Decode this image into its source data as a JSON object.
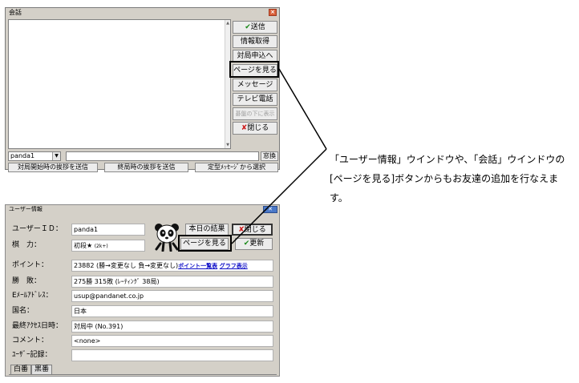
{
  "chat": {
    "title": "会話",
    "buttons": {
      "send": "送信",
      "get_info": "情報取得",
      "request_match": "対局申込へ",
      "view_page": "ページを見る",
      "message": "メッセージ",
      "tv_phone": "テレビ電話",
      "show_below_board": "碁盤の下に表示",
      "close": "閉じる"
    },
    "user_select_value": "panda1",
    "window_button": "窓換",
    "bottom_buttons": {
      "start_greeting": "対局開始時の挨拶を送信",
      "end_greeting": "終局時の挨拶を送信",
      "template_message": "定型ﾒｯｾｰｼﾞから選択"
    }
  },
  "note": {
    "text": "「ユーザー情報」ウインドウや、「会話」ウインドウの[ページを見る]ボタンからもお友達の追加を行なえます。"
  },
  "user_info": {
    "title": "ユーザー情報",
    "close_x": "✕",
    "fields": {
      "user_id_label": "ユーザーＩＤ：",
      "user_id_value": "panda1",
      "rank_label": "棋　力：",
      "rank_value": "初段★",
      "rank_suffix": "(2k+)",
      "points_label": "ポイント：",
      "points_value": "23882 (勝→変更なし 負→変更なし)",
      "points_link1": "ポイント一覧表",
      "points_link2": "グラフ表示",
      "record_label": "勝　敗：",
      "record_value": "275勝 315敗 (ﾚｰﾃｨﾝｸﾞ 38局)",
      "email_label": "Eﾒｰﾙｱﾄﾞﾚｽ：",
      "email_value": "usup@pandanet.co.jp",
      "country_label": "国名：",
      "country_value": "日本",
      "last_access_label": "最終ｱｸｾｽ日時：",
      "last_access_value": "対局中 (No.391)",
      "comment_label": "コメント：",
      "comment_value": "<none>",
      "user_record_label": "ﾕｰｻﾞｰ記録："
    },
    "buttons": {
      "today_results": "本日の結果",
      "close": "閉じる",
      "view_page": "ページを見る",
      "update": "更新"
    },
    "tabs": [
      "白番",
      "黒番"
    ]
  }
}
